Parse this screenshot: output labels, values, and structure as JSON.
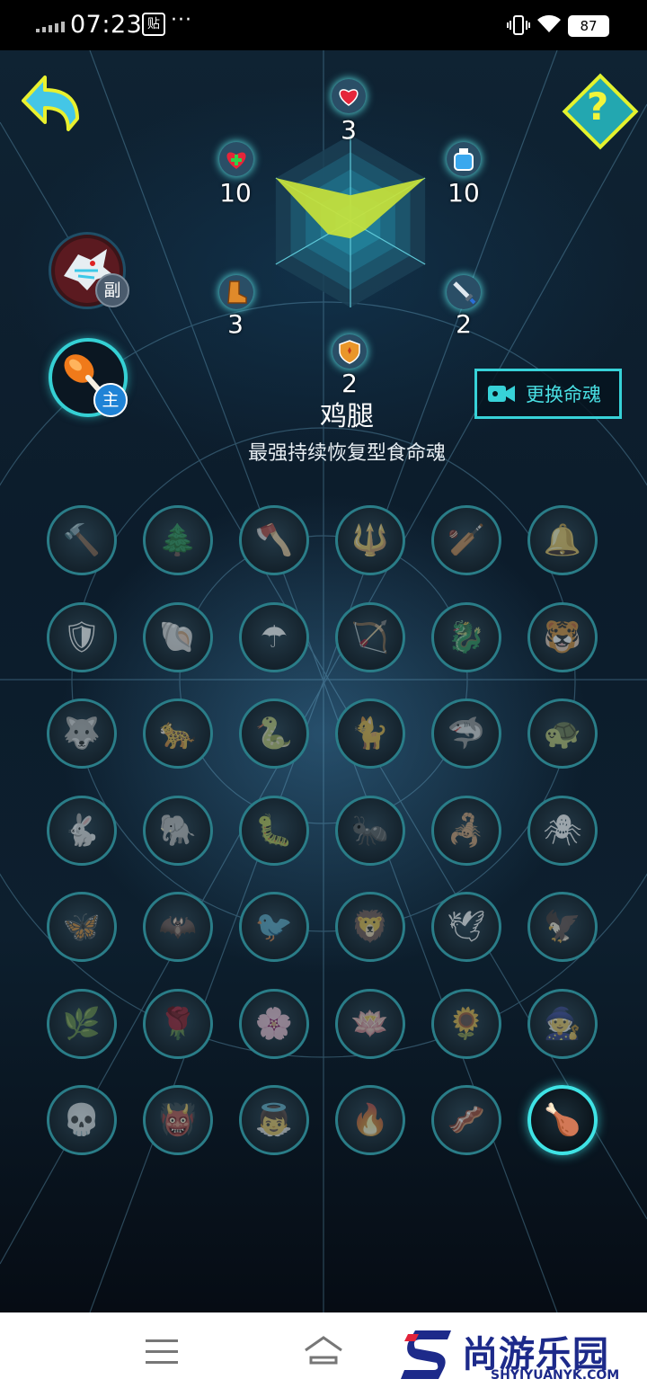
{
  "status_bar": {
    "time": "07:23",
    "notification_icon": "贴",
    "more": "···",
    "battery": "87"
  },
  "stats": {
    "health": "3",
    "heal": "10",
    "mana": "10",
    "speed": "3",
    "attack": "2",
    "defense": "2"
  },
  "radar_chart": {
    "axes": [
      "health",
      "mana",
      "attack",
      "defense",
      "speed",
      "heal"
    ],
    "values": [
      3,
      10,
      2,
      2,
      3,
      10
    ],
    "max": 10,
    "fill_color": "#c8e23a",
    "levels": 5
  },
  "soul_slots": {
    "sub_badge": "副",
    "main_badge": "主"
  },
  "change_button": {
    "label": "更换命魂"
  },
  "selected_soul": {
    "name": "鸡腿",
    "description": "最强持续恢复型食命魂"
  },
  "souls_grid": [
    {
      "icon": "hammer-icon",
      "glyph": "🔨"
    },
    {
      "icon": "tree-icon",
      "glyph": "🌲"
    },
    {
      "icon": "axe-icon",
      "glyph": "🪓"
    },
    {
      "icon": "spear-icon",
      "glyph": "🔱"
    },
    {
      "icon": "club-icon",
      "glyph": "🏏"
    },
    {
      "icon": "bell-icon",
      "glyph": "🔔"
    },
    {
      "icon": "mask-icon",
      "glyph": "🛡"
    },
    {
      "icon": "shell-icon",
      "glyph": "🐚"
    },
    {
      "icon": "umbrella-icon",
      "glyph": "☂"
    },
    {
      "icon": "bow-icon",
      "glyph": "🏹"
    },
    {
      "icon": "dragon-icon",
      "glyph": "🐉"
    },
    {
      "icon": "tiger-icon",
      "glyph": "🐯"
    },
    {
      "icon": "wolf-icon",
      "glyph": "🐺"
    },
    {
      "icon": "leopard-icon",
      "glyph": "🐆"
    },
    {
      "icon": "snake-icon",
      "glyph": "🐍"
    },
    {
      "icon": "cat-icon",
      "glyph": "🐈"
    },
    {
      "icon": "shark-icon",
      "glyph": "🦈"
    },
    {
      "icon": "turtle-icon",
      "glyph": "🐢"
    },
    {
      "icon": "rabbit-icon",
      "glyph": "🐇"
    },
    {
      "icon": "elephant-icon",
      "glyph": "🐘"
    },
    {
      "icon": "larva-icon",
      "glyph": "🐛"
    },
    {
      "icon": "ant-icon",
      "glyph": "🐜"
    },
    {
      "icon": "centipede-icon",
      "glyph": "🦂"
    },
    {
      "icon": "spider-icon",
      "glyph": "🕷"
    },
    {
      "icon": "butterfly-icon",
      "glyph": "🦋"
    },
    {
      "icon": "bat-icon",
      "glyph": "🦇"
    },
    {
      "icon": "bird-icon",
      "glyph": "🐦"
    },
    {
      "icon": "fire-beast-icon",
      "glyph": "🦁"
    },
    {
      "icon": "swallow-icon",
      "glyph": "🕊"
    },
    {
      "icon": "eagle-icon",
      "glyph": "🦅"
    },
    {
      "icon": "leaf-icon",
      "glyph": "🌿"
    },
    {
      "icon": "rose-icon",
      "glyph": "🌹"
    },
    {
      "icon": "violet-icon",
      "glyph": "🌸"
    },
    {
      "icon": "lotus-icon",
      "glyph": "🪷"
    },
    {
      "icon": "sunflower-icon",
      "glyph": "🌻"
    },
    {
      "icon": "witch-icon",
      "glyph": "🧙"
    },
    {
      "icon": "skull-icon",
      "glyph": "💀"
    },
    {
      "icon": "demon-icon",
      "glyph": "👹"
    },
    {
      "icon": "angel-icon",
      "glyph": "👼"
    },
    {
      "icon": "buddha-icon",
      "glyph": "🔥"
    },
    {
      "icon": "sausage-icon",
      "glyph": "🥓"
    },
    {
      "icon": "drumstick-icon",
      "glyph": "🍗"
    }
  ],
  "bottom_logo": {
    "name": "尚游乐园",
    "url": "SHYIYUANYK.COM"
  },
  "colors": {
    "accent": "#37d2d8",
    "help_fill": "#23a7b0",
    "help_border": "#e5f22c",
    "back_arrow": "#44c6e6"
  }
}
